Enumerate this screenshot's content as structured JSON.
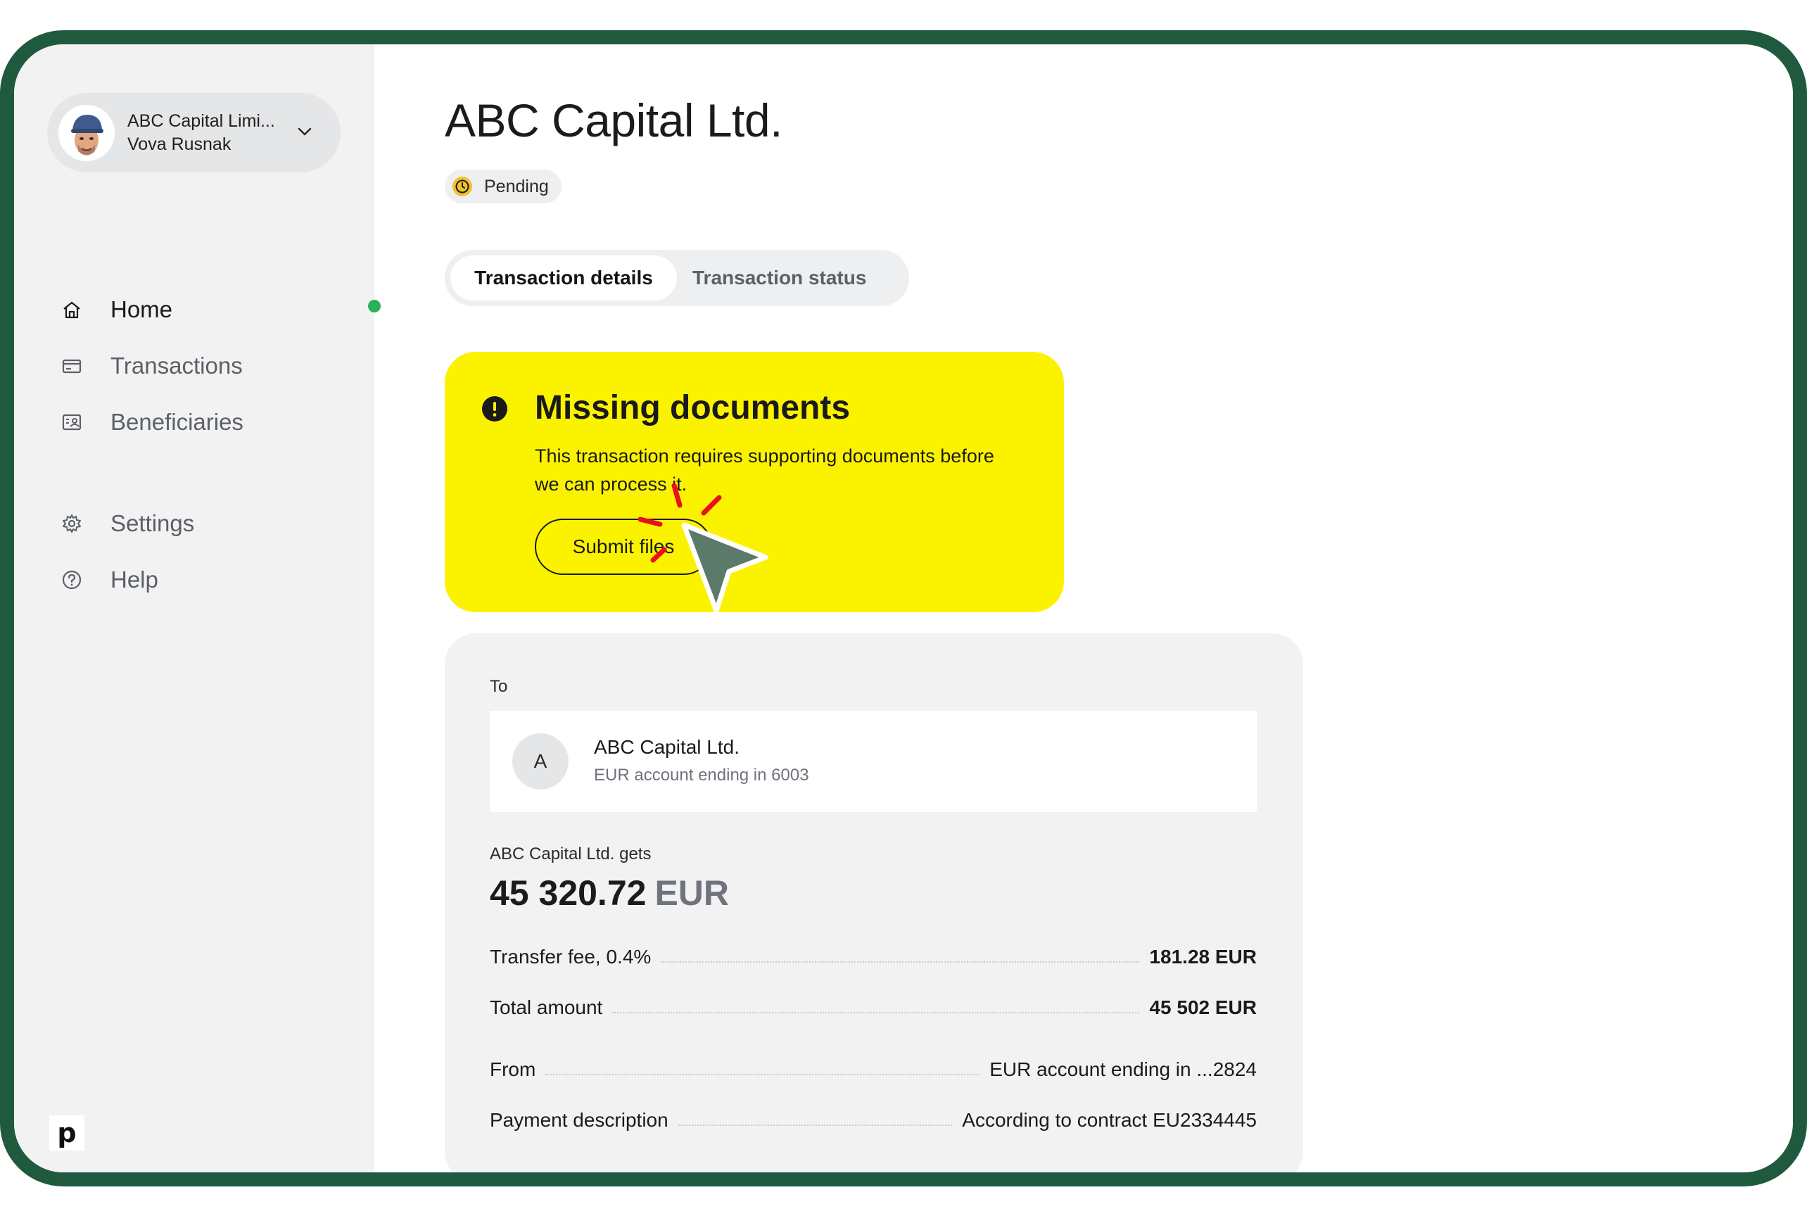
{
  "account": {
    "org": "ABC Capital Limi...",
    "user": "Vova Rusnak"
  },
  "nav": [
    {
      "label": "Home",
      "icon": "home-icon",
      "active": true
    },
    {
      "label": "Transactions",
      "icon": "card-icon",
      "active": false
    },
    {
      "label": "Beneficiaries",
      "icon": "contacts-icon",
      "active": false
    },
    {
      "label": "Settings",
      "icon": "gear-icon",
      "active": false
    },
    {
      "label": "Help",
      "icon": "help-icon",
      "active": false
    }
  ],
  "brand": "p",
  "page": {
    "title": "ABC Capital Ltd.",
    "status": "Pending"
  },
  "tabs": {
    "details": "Transaction details",
    "status": "Transaction status"
  },
  "alert": {
    "title": "Missing documents",
    "text": "This transaction requires supporting documents before we can process it.",
    "button": "Submit files"
  },
  "details": {
    "to_label": "To",
    "recipient_initial": "A",
    "recipient_name": "ABC Capital Ltd.",
    "recipient_account": "EUR account ending in 6003",
    "gets_label": "ABC Capital Ltd. gets",
    "amount": "45 320.72",
    "currency": "EUR",
    "rows": [
      {
        "key": "Transfer fee, 0.4%",
        "value": "181.28 EUR"
      },
      {
        "key": "Total amount",
        "value": "45 502 EUR"
      },
      {
        "key": "From",
        "value": "EUR account ending in ...2824"
      },
      {
        "key": "Payment description",
        "value": "According to contract EU2334445"
      }
    ]
  },
  "colors": {
    "frame": "#1f5a3e",
    "alert": "#fbf200",
    "pending": "#f2c12e",
    "active_dot": "#2bb05a",
    "cursor": "#5b7a6a",
    "sparkle": "#e8101d"
  }
}
